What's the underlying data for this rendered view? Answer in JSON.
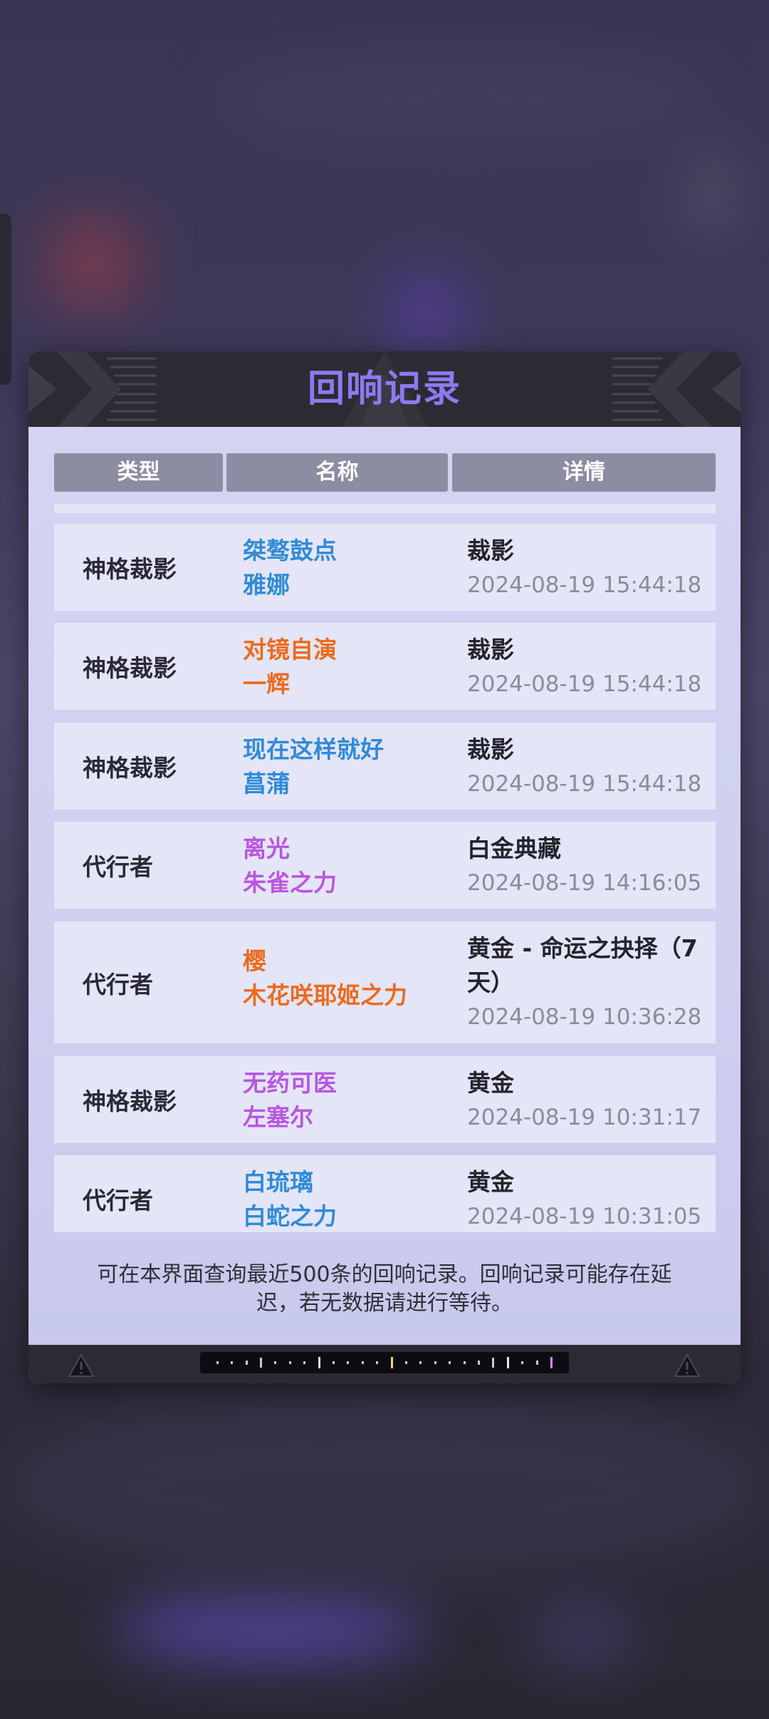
{
  "dialog": {
    "title": "回响记录",
    "columns": [
      "类型",
      "名称",
      "详情"
    ],
    "rows": [
      {
        "type": "神格裁影",
        "name1": "桀骜鼓点",
        "name2": "雅娜",
        "name_color": "#2f8bd8",
        "detail": "裁影",
        "time": "2024-08-19 15:44:18"
      },
      {
        "type": "神格裁影",
        "name1": "对镜自演",
        "name2": "一辉",
        "name_color": "#ec6a1c",
        "detail": "裁影",
        "time": "2024-08-19 15:44:18"
      },
      {
        "type": "神格裁影",
        "name1": "现在这样就好",
        "name2": "菖蒲",
        "name_color": "#2f8bd8",
        "detail": "裁影",
        "time": "2024-08-19 15:44:18"
      },
      {
        "type": "代行者",
        "name1": "离光",
        "name2": "朱雀之力",
        "name_color": "#b856e0",
        "detail": "白金典藏",
        "time": "2024-08-19 14:16:05"
      },
      {
        "type": "代行者",
        "name1": "樱",
        "name2": "木花咲耶姬之力",
        "name_color": "#ec6a1c",
        "detail": "黄金 - 命运之抉择（7天）",
        "time": "2024-08-19 10:36:28"
      },
      {
        "type": "神格裁影",
        "name1": "无药可医",
        "name2": "左塞尔",
        "name_color": "#b856e0",
        "detail": "黄金",
        "time": "2024-08-19 10:31:17"
      },
      {
        "type": "代行者",
        "name1": "白琉璃",
        "name2": "白蛇之力",
        "name_color": "#2f8bd8",
        "detail": "黄金",
        "time": "2024-08-19 10:31:05"
      }
    ],
    "footer_note": "可在本界面查询最近500条的回响记录。回响记录可能存在延迟，若无数据请进行等待。"
  },
  "colors": {
    "title": "#8e79f2",
    "header_bg": "#2c2b33",
    "column_header_bg": "#8c8ca3",
    "row_bg": "#e4e5f7",
    "time_text": "#8b8b99"
  },
  "icons": [
    "warning-icon-left",
    "warning-icon-right"
  ]
}
